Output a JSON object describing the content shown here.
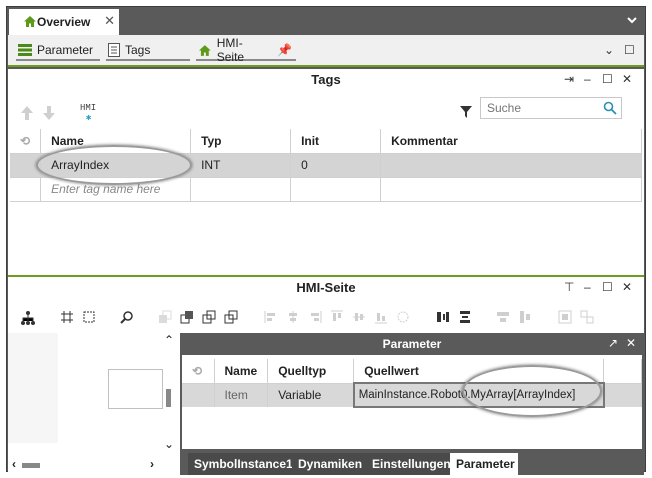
{
  "top_tab": {
    "label": "Overview"
  },
  "editor_tabs": [
    {
      "label": "Parameter"
    },
    {
      "label": "Tags"
    },
    {
      "label": "HMI-Seite"
    }
  ],
  "tags_panel": {
    "title": "Tags",
    "search_placeholder": "Suche",
    "toolbar_hmi": "HMI",
    "columns": [
      "Name",
      "Typ",
      "Init",
      "Kommentar"
    ],
    "rows": [
      {
        "name": "ArrayIndex",
        "type": "INT",
        "init": "0",
        "comment": ""
      }
    ],
    "new_row_placeholder": "Enter tag name here"
  },
  "hmi_panel": {
    "title": "HMI-Seite"
  },
  "parameter_panel": {
    "title": "Parameter",
    "columns": [
      "Name",
      "Quelltyp",
      "Quellwert"
    ],
    "rows": [
      {
        "name": "Item",
        "source_type": "Variable",
        "source_value": "MainInstance.Robot0.MyArray[ArrayIndex]"
      }
    ],
    "bottom_tabs": [
      "SymbolInstance1",
      "Dynamiken",
      "Einstellungen",
      "Parameter"
    ],
    "active_tab": "Parameter"
  },
  "colors": {
    "accent": "#6e9d1e",
    "dark_chrome": "#5a5a5a",
    "selection": "#d4d4d4"
  }
}
